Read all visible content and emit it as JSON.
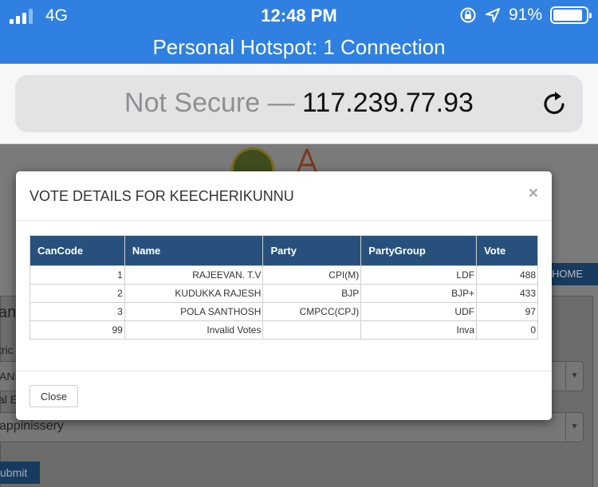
{
  "status_bar": {
    "carrier": "4G",
    "time": "12:48 PM",
    "battery": "91%",
    "battery_level": 0.91,
    "signal_bars": 3
  },
  "hotspot_banner": "Personal Hotspot: 1 Connection",
  "address_bar": {
    "prefix": "Not Secure — ",
    "host": "117.239.77.93"
  },
  "background_page": {
    "home_button": "HOME",
    "heading_fragment": "an",
    "district_label_fragment": "tric",
    "district_value_fragment": "ANI",
    "local_body_label_fragment": "al E",
    "local_body_value": "appinissery",
    "submit_label": "ubmit"
  },
  "modal": {
    "title": "VOTE DETAILS FOR KEECHERIKUNNU",
    "close_symbol": "×",
    "columns": [
      "CanCode",
      "Name",
      "Party",
      "PartyGroup",
      "Vote"
    ],
    "rows": [
      [
        "1",
        "RAJEEVAN. T.V",
        "CPI(M)",
        "LDF",
        "488"
      ],
      [
        "2",
        "KUDUKKA RAJESH",
        "BJP",
        "BJP+",
        "433"
      ],
      [
        "3",
        "POLA SANTHOSH",
        "CMPCC(CPJ)",
        "UDF",
        "97"
      ],
      [
        "99",
        "Invalid Votes",
        "",
        "Inva",
        "0"
      ]
    ],
    "close_button": "Close"
  }
}
